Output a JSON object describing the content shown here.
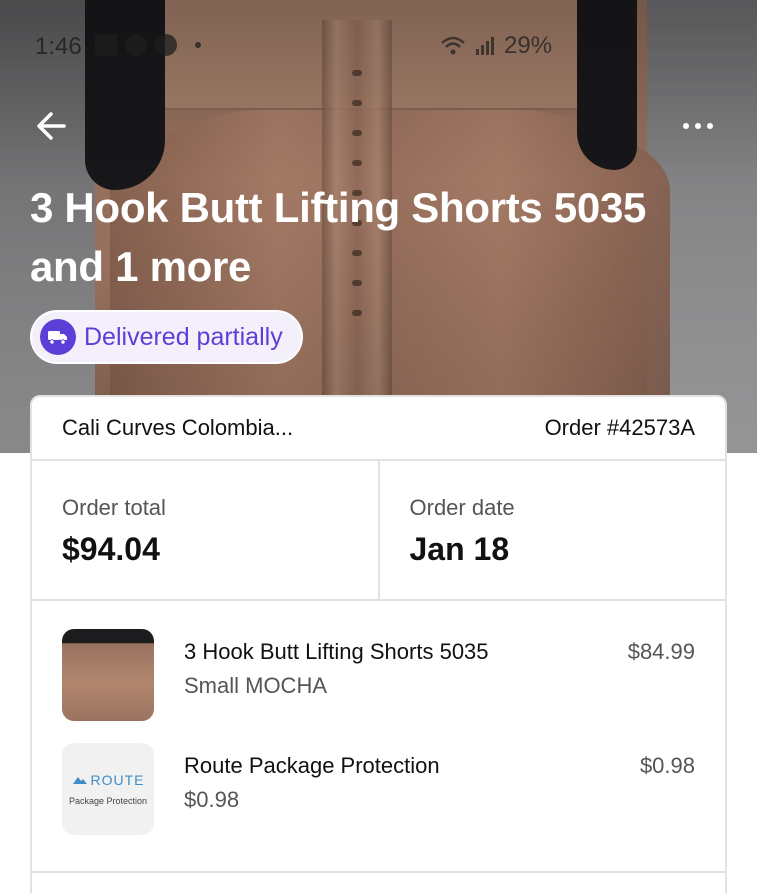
{
  "status_bar": {
    "time": "1:46",
    "battery": "29%"
  },
  "header": {
    "title": "3 Hook Butt Lifting Shorts 5035 and 1 more",
    "status_badge": "Delivered partially"
  },
  "order": {
    "store_name": "Cali Curves Colombia...",
    "order_number": "Order #42573A",
    "total_label": "Order total",
    "total_value": "$94.04",
    "date_label": "Order date",
    "date_value": "Jan 18"
  },
  "items": [
    {
      "name": "3 Hook Butt Lifting Shorts 5035",
      "variant": "Small MOCHA",
      "price": "$84.99",
      "thumbnail": "shorts-photo"
    },
    {
      "name": "Route Package Protection",
      "variant": "$0.98",
      "price": "$0.98",
      "thumbnail_logo": "ROUTE",
      "thumbnail_caption": "Package Protection"
    }
  ],
  "colors": {
    "accent": "#5b3fd6",
    "route_blue": "#3e8dc7"
  }
}
